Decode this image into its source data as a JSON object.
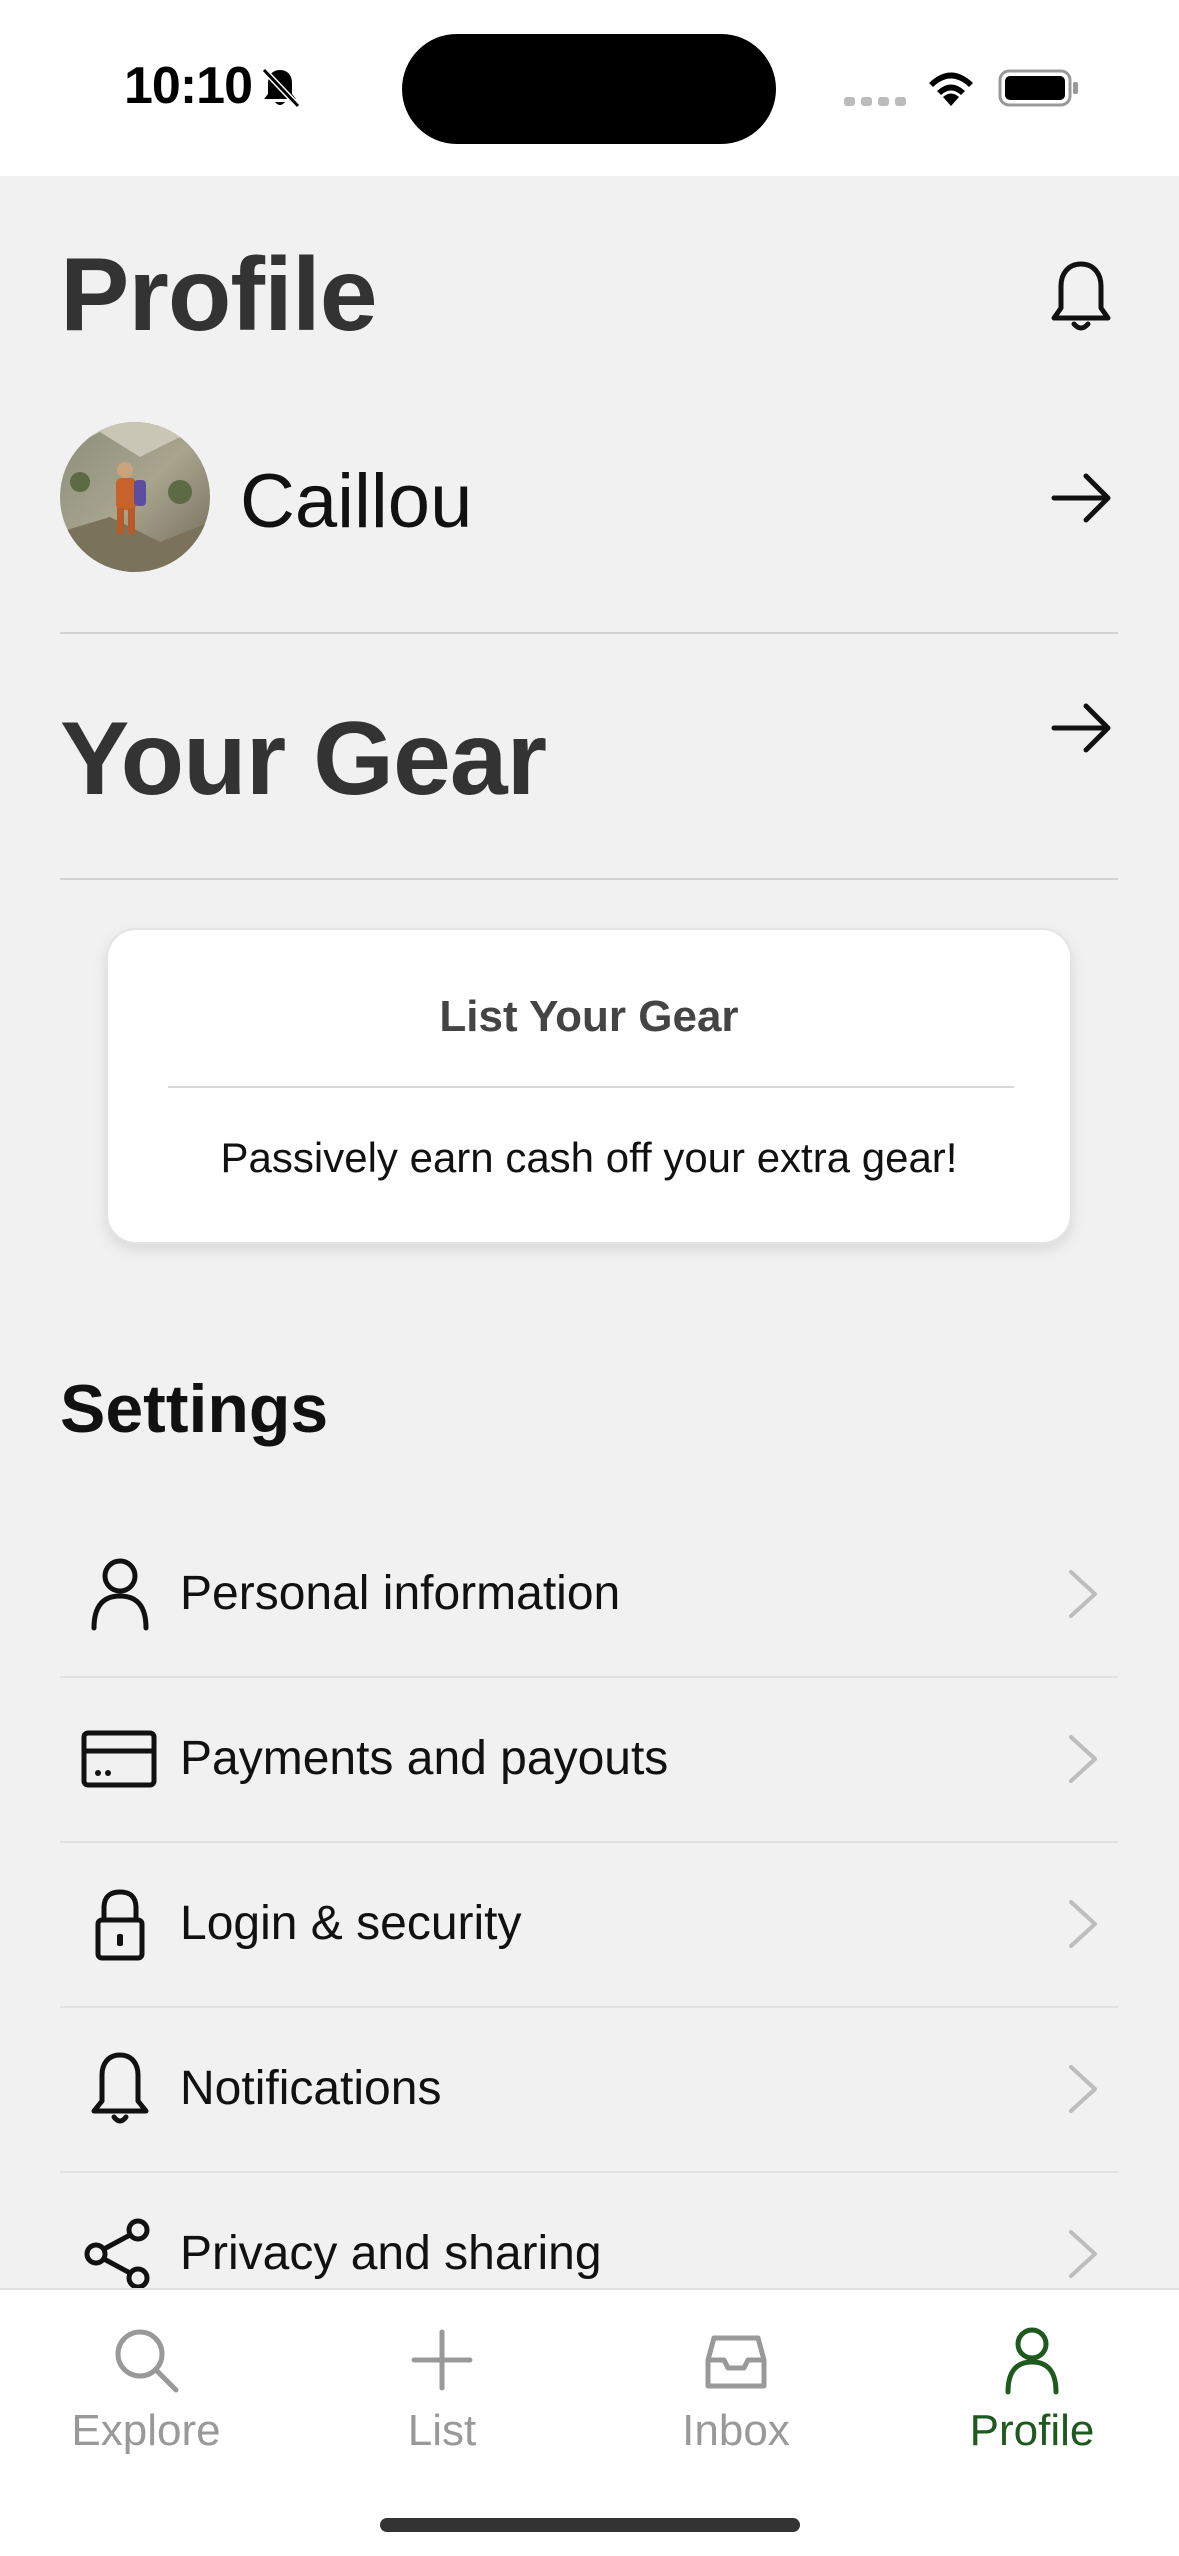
{
  "status_bar": {
    "time": "10:10"
  },
  "header": {
    "title": "Profile"
  },
  "profile": {
    "name": "Caillou"
  },
  "gear": {
    "title": "Your Gear",
    "card": {
      "title": "List Your Gear",
      "text": "Passively earn cash off your extra gear!"
    }
  },
  "settings": {
    "title": "Settings",
    "items": [
      {
        "label": "Personal information",
        "icon": "person-icon"
      },
      {
        "label": "Payments and payouts",
        "icon": "credit-card-icon"
      },
      {
        "label": "Login & security",
        "icon": "lock-icon"
      },
      {
        "label": "Notifications",
        "icon": "bell-icon"
      },
      {
        "label": "Privacy and sharing",
        "icon": "share-icon"
      }
    ]
  },
  "tabs": [
    {
      "label": "Explore",
      "icon": "search-icon",
      "active": false
    },
    {
      "label": "List",
      "icon": "plus-icon",
      "active": false
    },
    {
      "label": "Inbox",
      "icon": "inbox-icon",
      "active": false
    },
    {
      "label": "Profile",
      "icon": "person-icon",
      "active": true
    }
  ],
  "colors": {
    "accent": "#1e5a1e",
    "inactive": "#999999",
    "background": "#f1f1f1"
  }
}
